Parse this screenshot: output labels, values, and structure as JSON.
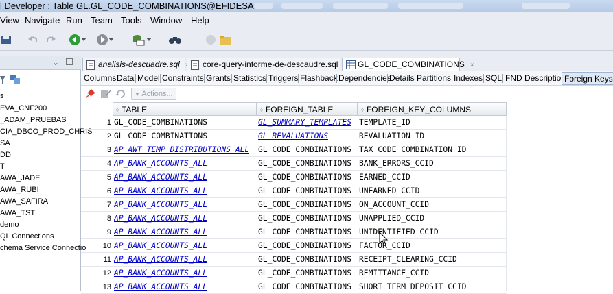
{
  "window": {
    "title": "l Developer : Table GL.GL_CODE_COMBINATIONS@EFIDESA"
  },
  "menu": [
    {
      "label": "View"
    },
    {
      "label": "Navigate"
    },
    {
      "label": "Run"
    },
    {
      "label": "Team"
    },
    {
      "label": "Tools"
    },
    {
      "label": "Window"
    },
    {
      "label": "Help"
    }
  ],
  "nav": {
    "items": [
      "s",
      "EVA_CNF200",
      "_ADAM_PRUEBAS",
      "CIA_DBCO_PROD_CHRIS",
      "SA",
      "DD",
      "T",
      "AWA_JADE",
      "AWA_RUBI",
      "AWA_SAFIRA",
      "AWA_TST",
      "demo",
      "QL Connections",
      "chema Service Connectio"
    ]
  },
  "editor_tabs": [
    {
      "label": "analisis-descuadre.sql",
      "close": "×"
    },
    {
      "label": "core-query-informe-de-descaudre.sql",
      "close": "×"
    },
    {
      "label": "GL_CODE_COMBINATIONS",
      "close": "×"
    }
  ],
  "sub_tabs": [
    "Columns",
    "Data",
    "Model",
    "Constraints",
    "Grants",
    "Statistics",
    "Triggers",
    "Flashback",
    "Dependencies",
    "Details",
    "Partitions",
    "Indexes",
    "SQL",
    "FND Description",
    "Foreign Keys"
  ],
  "actions_label": "Actions...",
  "grid": {
    "columns": [
      "TABLE",
      "FOREIGN_TABLE",
      "FOREIGN_KEY_COLUMNS"
    ],
    "rows": [
      {
        "n": "1",
        "table": "GL_CODE_COMBINATIONS",
        "foreign_table": "GL_SUMMARY_TEMPLATES",
        "fk": "TEMPLATE_ID"
      },
      {
        "n": "2",
        "table": "GL_CODE_COMBINATIONS",
        "foreign_table": "GL_REVALUATIONS",
        "fk": "REVALUATION_ID"
      },
      {
        "n": "3",
        "table": "AP_AWT_TEMP_DISTRIBUTIONS_ALL",
        "foreign_table": "GL_CODE_COMBINATIONS",
        "fk": "TAX_CODE_COMBINATION_ID"
      },
      {
        "n": "4",
        "table": "AP_BANK_ACCOUNTS_ALL",
        "foreign_table": "GL_CODE_COMBINATIONS",
        "fk": "BANK_ERRORS_CCID"
      },
      {
        "n": "5",
        "table": "AP_BANK_ACCOUNTS_ALL",
        "foreign_table": "GL_CODE_COMBINATIONS",
        "fk": "EARNED_CCID"
      },
      {
        "n": "6",
        "table": "AP_BANK_ACCOUNTS_ALL",
        "foreign_table": "GL_CODE_COMBINATIONS",
        "fk": "UNEARNED_CCID"
      },
      {
        "n": "7",
        "table": "AP_BANK_ACCOUNTS_ALL",
        "foreign_table": "GL_CODE_COMBINATIONS",
        "fk": "ON_ACCOUNT_CCID"
      },
      {
        "n": "8",
        "table": "AP_BANK_ACCOUNTS_ALL",
        "foreign_table": "GL_CODE_COMBINATIONS",
        "fk": "UNAPPLIED_CCID"
      },
      {
        "n": "9",
        "table": "AP_BANK_ACCOUNTS_ALL",
        "foreign_table": "GL_CODE_COMBINATIONS",
        "fk": "UNIDENTIFIED_CCID"
      },
      {
        "n": "10",
        "table": "AP_BANK_ACCOUNTS_ALL",
        "foreign_table": "GL_CODE_COMBINATIONS",
        "fk": "FACTOR_CCID"
      },
      {
        "n": "11",
        "table": "AP_BANK_ACCOUNTS_ALL",
        "foreign_table": "GL_CODE_COMBINATIONS",
        "fk": "RECEIPT_CLEARING_CCID"
      },
      {
        "n": "12",
        "table": "AP_BANK_ACCOUNTS_ALL",
        "foreign_table": "GL_CODE_COMBINATIONS",
        "fk": "REMITTANCE_CCID"
      },
      {
        "n": "13",
        "table": "AP_BANK_ACCOUNTS_ALL",
        "foreign_table": "GL_CODE_COMBINATIONS",
        "fk": "SHORT_TERM_DEPOSIT_CCID"
      }
    ]
  },
  "colors": {
    "link": "#0000cc",
    "accent": "#9fb4d0"
  }
}
